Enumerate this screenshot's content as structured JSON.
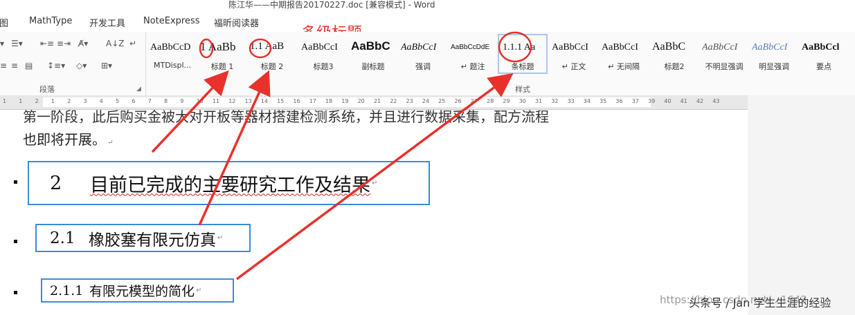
{
  "window": {
    "title": "陈江华——中期报告20170227.doc [兼容模式] - Word"
  },
  "tabs": [
    "图",
    "MathType",
    "开发工具",
    "NoteExpress",
    "福昕阅读器"
  ],
  "ribbon": {
    "paragraph_group_label": "段落",
    "styles_group_label": "样式",
    "styles": [
      {
        "sample": "AaBbCcD",
        "name": "MTDispl..."
      },
      {
        "sample": "1 AaBb",
        "name": "标题 1"
      },
      {
        "sample": "1.1 AaB",
        "name": "标题 2"
      },
      {
        "sample": "AaBbCcI",
        "name": "标题3"
      },
      {
        "sample": "AaBbC",
        "name": "副标题"
      },
      {
        "sample": "AaBbCcI",
        "name": "强调"
      },
      {
        "sample": "AaBbCcDdE",
        "name": "↵ 题注"
      },
      {
        "sample": "1.1.1 Aa",
        "name": "条标题"
      },
      {
        "sample": "AaBbCcI",
        "name": "↵ 正文"
      },
      {
        "sample": "AaBbCcI",
        "name": "↵ 无间隔"
      },
      {
        "sample": "AaBbC",
        "name": "标题2"
      },
      {
        "sample": "AaBbCcI",
        "name": "不明显强调"
      },
      {
        "sample": "AaBbCcI",
        "name": "明显强调"
      },
      {
        "sample": "AaBbCcl",
        "name": "要点"
      }
    ]
  },
  "ruler": {
    "numbers": [
      "1",
      "1",
      "2",
      "1",
      "2",
      "3",
      "4",
      "5",
      "6",
      "7",
      "8",
      "9",
      "10",
      "11",
      "12",
      "13",
      "14",
      "15",
      "16",
      "17",
      "18",
      "19",
      "20",
      "21",
      "22",
      "23",
      "24",
      "25",
      "26",
      "27",
      "28",
      "29",
      "30",
      "31",
      "32",
      "33",
      "34",
      "35",
      "36",
      "37",
      "39",
      "40",
      "41",
      "42",
      "43"
    ]
  },
  "annotation": {
    "label": "多级标题"
  },
  "document": {
    "line1": "第一阶段，此后购买金被大对开板等器材搭建检测系统，并且进行数据采集，配方流程",
    "line2": "也即将开展。",
    "heading1": {
      "number": "2",
      "text": "目前已完成的主要研究工作及结果"
    },
    "heading2": {
      "number": "2.1",
      "text": "橡胶塞有限元仿真"
    },
    "heading3": {
      "number": "2.1.1",
      "text": "有限元模型的简化"
    }
  },
  "watermark": {
    "url": "https://blog.csdn.net/...1643",
    "credit": "头条号 / Jan 学生生涯的经验"
  },
  "colors": {
    "annotation_red": "#e8312b",
    "heading_border": "#3b8ad8",
    "selected_style": "#a8c8ea"
  }
}
